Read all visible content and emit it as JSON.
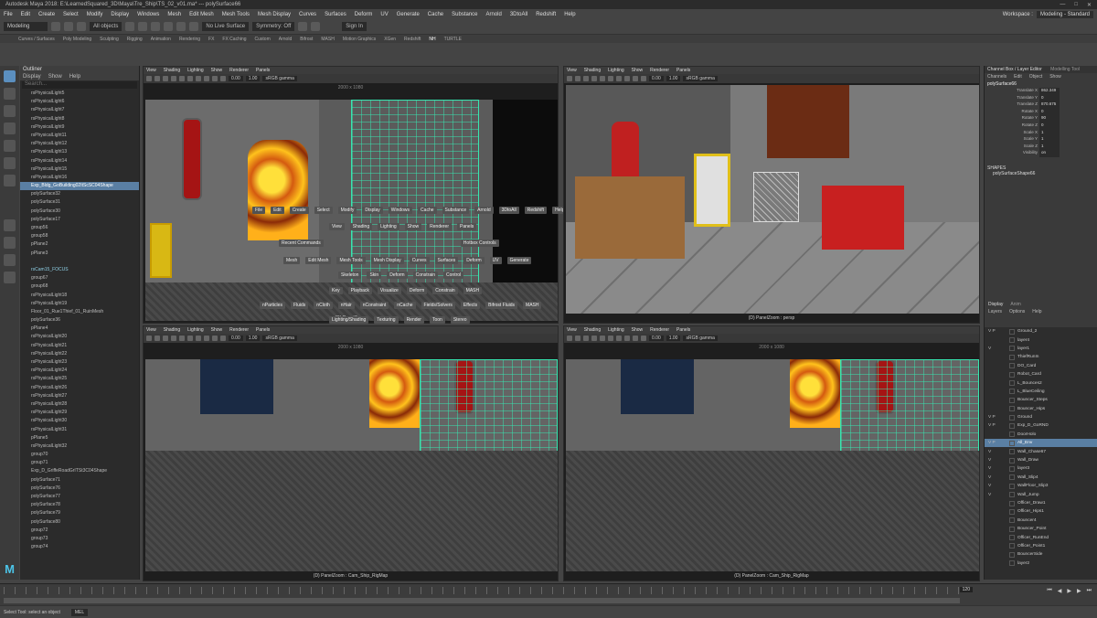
{
  "window": {
    "title": "Autodesk Maya 2018: E:\\LearnedSquared_3D\\Maya\\Tre_Ship\\TS_02_v01.ma* --- polySurface66",
    "controls": [
      "—",
      "□",
      "✕"
    ]
  },
  "menubar": {
    "items": [
      "File",
      "Edit",
      "Create",
      "Select",
      "Modify",
      "Display",
      "Windows",
      "Mesh",
      "Edit Mesh",
      "Mesh Tools",
      "Mesh Display",
      "Curves",
      "Surfaces",
      "Deform",
      "UV",
      "Generate",
      "Cache",
      "Substance",
      "Arnold",
      "3DtoAll",
      "Redshift",
      "Help"
    ],
    "workspace_label": "Workspace :",
    "workspace_value": "Modeling - Standard"
  },
  "statusline": {
    "mode": "Modeling",
    "objects": "All objects",
    "live_surface": "No Live Surface",
    "symmetry": "Symmetry: Off",
    "signin": "Sign In"
  },
  "shelf_tabs": [
    "Curves / Surfaces",
    "Poly Modeling",
    "Sculpting",
    "Rigging",
    "Animation",
    "Rendering",
    "FX",
    "FX Caching",
    "Custom",
    "Arnold",
    "Bifrost",
    "MASH",
    "Motion Graphics",
    "XGen",
    "Redshift",
    "NH",
    "TURTLE"
  ],
  "shelf_active": "NH",
  "outliner": {
    "title": "Outliner",
    "menu": [
      "Display",
      "Show",
      "Help"
    ],
    "search_placeholder": "Search...",
    "rows": [
      "rsPhysicalLight5",
      "rsPhysicalLight6",
      "rsPhysicalLight7",
      "rsPhysicalLight8",
      "rsPhysicalLight9",
      "rsPhysicalLight11",
      "rsPhysicalLight12",
      "rsPhysicalLight13",
      "rsPhysicalLight14",
      "rsPhysicalLight15",
      "rsPhysicalLight16",
      "Exp_Bldg_GoBuilding02ItScSC04Shape",
      "polySurface32",
      "polySurface31",
      "polySurface30",
      "polySurface17",
      "group56",
      "group58",
      "pPlane2",
      "pPlane3",
      "",
      "rsCam15_FOCUS",
      "group67",
      "group68",
      "rsPhysicalLight18",
      "rsPhysicalLight19",
      "Floor_01_Rue1Thief_01_RuinMesh",
      "polySurface36",
      "pPlane4",
      "rsPhysicalLight20",
      "rsPhysicalLight21",
      "rsPhysicalLight22",
      "rsPhysicalLight23",
      "rsPhysicalLight24",
      "rsPhysicalLight25",
      "rsPhysicalLight26",
      "rsPhysicalLight27",
      "rsPhysicalLight28",
      "rsPhysicalLight29",
      "rsPhysicalLight30",
      "rsPhysicalLight31",
      "pPlane5",
      "rsPhysicalLight32",
      "group70",
      "group71",
      "Exp_D_GriffeRoadGrITSt3C04Shape",
      "polySurface71",
      "polySurface76",
      "polySurface77",
      "polySurface78",
      "polySurface79",
      "polySurface80",
      "group72",
      "group73",
      "group74"
    ],
    "highlight_index": 11
  },
  "viewports": {
    "menu": [
      "View",
      "Shading",
      "Lighting",
      "Show",
      "Renderer",
      "Panels"
    ],
    "gamma": "sRGB gamma",
    "v0": "0.00",
    "v1": "1.00",
    "tl": {
      "resolution": "2000 x 1080",
      "camera": "(D) PanelZoom"
    },
    "tr": {
      "camera": "(D) PanelZoom : persp"
    },
    "bl": {
      "resolution": "2000 x 1080",
      "camera": "(D) PanelZoom : Cam_Ship_RigMap"
    },
    "br": {
      "resolution": "2000 x 1080",
      "camera": "(D) PanelZoom : Cam_Ship_RigMap"
    }
  },
  "hotbox": {
    "row1": [
      "File",
      "Edit",
      "Create",
      "Select",
      "Modify",
      "Display",
      "Windows",
      "Cache",
      "Substance",
      "Arnold",
      "3DtoAll",
      "Redshift",
      "Help"
    ],
    "row2": [
      "View",
      "Shading",
      "Lighting",
      "Show",
      "Renderer",
      "Panels"
    ],
    "recent": "Recent Commands",
    "hotbox_controls": "Hotbox Controls",
    "row3": [
      "Mesh",
      "Edit Mesh",
      "Mesh Tools",
      "Mesh Display",
      "Curves",
      "Surfaces",
      "Deform",
      "UV",
      "Generate"
    ],
    "row4": [
      "Skeleton",
      "Skin",
      "Deform",
      "Constrain",
      "Control"
    ],
    "row5": [
      "Key",
      "Playback",
      "Visualize",
      "Deform",
      "Constrain",
      "MASH"
    ],
    "row6": [
      "nParticles",
      "Fluids",
      "nCloth",
      "nHair",
      "nConstraint",
      "nCache",
      "Fields/Solvers",
      "Effects",
      "Bifrost Fluids",
      "MASH"
    ],
    "row7": [
      "Lighting/Shading",
      "Texturing",
      "Render",
      "Toon",
      "Stereo"
    ]
  },
  "channel_box": {
    "title": "Channel Box / Layer Editor",
    "title2": "Modelling Tool",
    "menu": [
      "Channels",
      "Edit",
      "Object",
      "Show"
    ],
    "object": "polySurface66",
    "attrs": [
      {
        "k": "Translate X",
        "v": "862.349"
      },
      {
        "k": "Translate Y",
        "v": "0"
      },
      {
        "k": "Translate Z",
        "v": "870.675"
      },
      {
        "k": "Rotate X",
        "v": "0"
      },
      {
        "k": "Rotate Y",
        "v": "90"
      },
      {
        "k": "Rotate Z",
        "v": "0"
      },
      {
        "k": "Scale X",
        "v": "1"
      },
      {
        "k": "Scale Y",
        "v": "1"
      },
      {
        "k": "Scale Z",
        "v": "1"
      },
      {
        "k": "Visibility",
        "v": "on"
      }
    ],
    "shapes_label": "SHAPES",
    "shape_name": "polySurfaceShape66"
  },
  "layers": {
    "tabs": [
      "Display",
      "Anim"
    ],
    "menu": [
      "Layers",
      "Options",
      "Help"
    ],
    "rows": [
      {
        "vp": "V P",
        "name": "Ground_2"
      },
      {
        "vp": "",
        "name": "layer4"
      },
      {
        "vp": "V",
        "name": "layer1"
      },
      {
        "vp": "",
        "name": "ThiefRunIn"
      },
      {
        "vp": "",
        "name": "DO_Card"
      },
      {
        "vp": "",
        "name": "Robot_Card"
      },
      {
        "vp": "",
        "name": "L_Bounces2"
      },
      {
        "vp": "",
        "name": "L_BlueCeiling"
      },
      {
        "vp": "",
        "name": "Bouncer_Steps"
      },
      {
        "vp": "",
        "name": "Bouncer_Hips"
      },
      {
        "vp": "V P",
        "name": "Ground"
      },
      {
        "vp": "V P",
        "name": "Exp_D_GoRND"
      },
      {
        "vp": "",
        "name": "DoorHolo"
      },
      {
        "vp": "V P",
        "name": "All_Env"
      },
      {
        "vp": "V",
        "name": "Wall_Chase67"
      },
      {
        "vp": "V",
        "name": "Wall_Draw"
      },
      {
        "vp": "V",
        "name": "layer3"
      },
      {
        "vp": "V",
        "name": "Wall_Slip4"
      },
      {
        "vp": "V",
        "name": "WallFloor_Slip3"
      },
      {
        "vp": "V",
        "name": "Wall_Jump"
      },
      {
        "vp": "",
        "name": "Officer_Draw1"
      },
      {
        "vp": "",
        "name": "Officer_Hips1"
      },
      {
        "vp": "",
        "name": "Bouncer4"
      },
      {
        "vp": "",
        "name": "Bouncer_Point"
      },
      {
        "vp": "",
        "name": "Officer_RunEnd"
      },
      {
        "vp": "",
        "name": "Officer_Point1"
      },
      {
        "vp": "",
        "name": "BouncerSide"
      },
      {
        "vp": "",
        "name": "layer2"
      }
    ],
    "highlight_index": 13
  },
  "timeline": {
    "current_frame": "120",
    "end_frame": "120"
  },
  "helpline": {
    "mel_label": "MEL",
    "message": "Select Tool: select an object"
  },
  "colors": {
    "accent": "#5a7fa3",
    "wireframe": "#37e6b0",
    "maya_logo": "#4cc4e8"
  }
}
